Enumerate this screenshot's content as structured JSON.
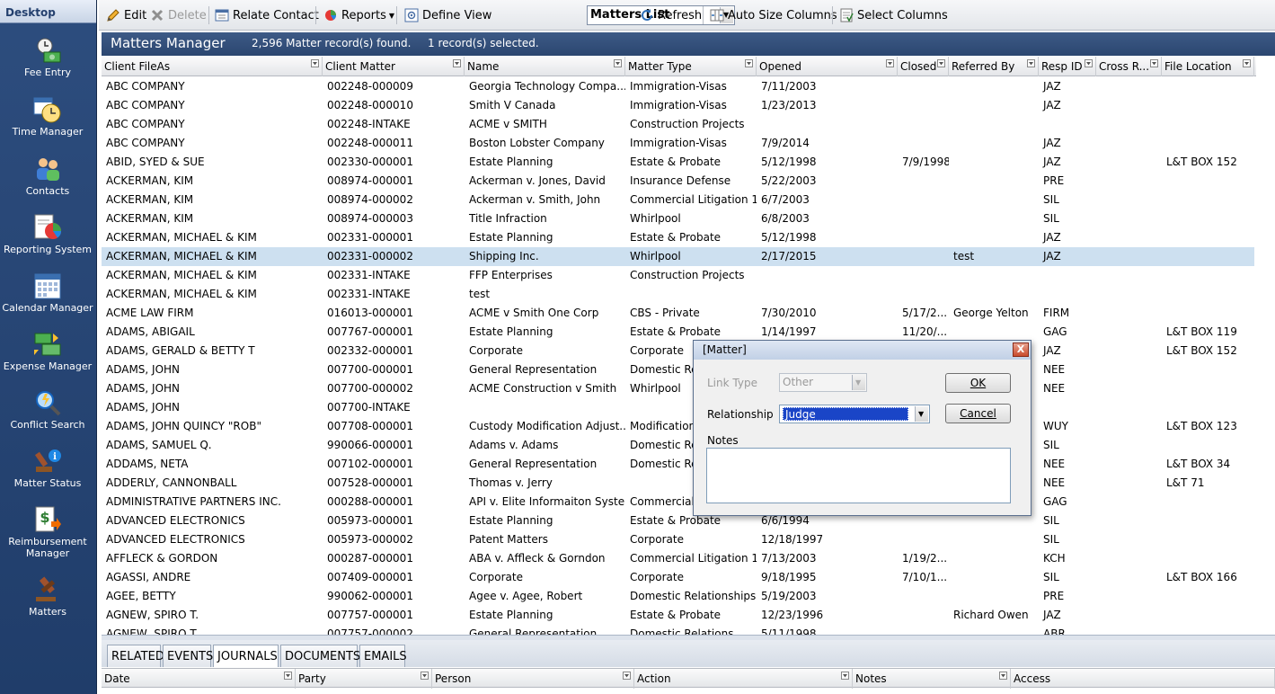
{
  "sidebar": {
    "title": "Desktop",
    "items": [
      {
        "label": "Fee Entry",
        "icon": "fee-entry-icon"
      },
      {
        "label": "Time Manager",
        "icon": "time-manager-icon"
      },
      {
        "label": "Contacts",
        "icon": "contacts-icon"
      },
      {
        "label": "Reporting System",
        "icon": "reporting-system-icon"
      },
      {
        "label": "Calendar Manager",
        "icon": "calendar-manager-icon"
      },
      {
        "label": "Expense Manager",
        "icon": "expense-manager-icon"
      },
      {
        "label": "Conflict Search",
        "icon": "conflict-search-icon"
      },
      {
        "label": "Matter Status",
        "icon": "matter-status-icon"
      },
      {
        "label": "Reimbursement Manager",
        "icon": "reimbursement-manager-icon"
      },
      {
        "label": "Matters",
        "icon": "matters-icon"
      }
    ]
  },
  "toolbar": {
    "edit": "Edit",
    "delete": "Delete",
    "relate_contact": "Relate Contact",
    "reports": "Reports",
    "define_view": "Define View",
    "view_value": "Matters List",
    "refresh": "Refresh",
    "auto_size": "Auto Size Columns",
    "select_columns": "Select Columns"
  },
  "header": {
    "title": "Matters Manager",
    "records_found": "2,596 Matter record(s) found.",
    "records_selected": "1 record(s) selected."
  },
  "columns": [
    "Client FileAs",
    "Client Matter",
    "Name",
    "Matter Type",
    "Opened",
    "Closed",
    "Referred By",
    "Resp ID",
    "Cross R...",
    "File Location"
  ],
  "rows": [
    [
      "ABC COMPANY",
      "002248-000009",
      "Georgia Technology Compa...",
      "Immigration-Visas",
      "7/11/2003",
      "",
      "",
      "JAZ",
      "",
      ""
    ],
    [
      "ABC COMPANY",
      "002248-000010",
      "Smith V Canada",
      "Immigration-Visas",
      "1/23/2013",
      "",
      "",
      "JAZ",
      "",
      ""
    ],
    [
      "ABC COMPANY",
      "002248-INTAKE",
      "ACME v SMITH",
      "Construction Projects",
      "",
      "",
      "",
      "",
      "",
      ""
    ],
    [
      "ABC COMPANY",
      "002248-000011",
      "Boston Lobster Company",
      "Immigration-Visas",
      "7/9/2014",
      "",
      "",
      "JAZ",
      "",
      ""
    ],
    [
      "ABID, SYED & SUE",
      "002330-000001",
      "Estate Planning",
      "Estate & Probate",
      "5/12/1998",
      "7/9/1998",
      "",
      "JAZ",
      "",
      "L&T BOX 152"
    ],
    [
      "ACKERMAN, KIM",
      "008974-000001",
      "Ackerman v. Jones, David",
      "Insurance Defense",
      "5/22/2003",
      "",
      "",
      "PRE",
      "",
      ""
    ],
    [
      "ACKERMAN, KIM",
      "008974-000002",
      "Ackerman v. Smith, John",
      "Commercial Litigation  1",
      "6/7/2003",
      "",
      "",
      "SIL",
      "",
      ""
    ],
    [
      "ACKERMAN, KIM",
      "008974-000003",
      "Title Infraction",
      "Whirlpool",
      "6/8/2003",
      "",
      "",
      "SIL",
      "",
      ""
    ],
    [
      "ACKERMAN, MICHAEL & KIM",
      "002331-000001",
      "Estate Planning",
      "Estate & Probate",
      "5/12/1998",
      "",
      "",
      "JAZ",
      "",
      ""
    ],
    [
      "ACKERMAN, MICHAEL & KIM",
      "002331-000002",
      "Shipping Inc.",
      "Whirlpool",
      "2/17/2015",
      "",
      "test",
      "JAZ",
      "",
      ""
    ],
    [
      "ACKERMAN, MICHAEL & KIM",
      "002331-INTAKE",
      "FFP Enterprises",
      "Construction Projects",
      "",
      "",
      "",
      "",
      "",
      ""
    ],
    [
      "ACKERMAN, MICHAEL & KIM",
      "002331-INTAKE",
      "test",
      "",
      "",
      "",
      "",
      "",
      "",
      ""
    ],
    [
      "ACME LAW FIRM",
      "016013-000001",
      "ACME v Smith One Corp",
      "CBS - Private",
      "7/30/2010",
      "5/17/2...",
      "George Yelton",
      "FIRM",
      "",
      ""
    ],
    [
      "ADAMS, ABIGAIL",
      "007767-000001",
      "Estate Planning",
      "Estate & Probate",
      "1/14/1997",
      "11/20/...",
      "",
      "GAG",
      "",
      "L&T BOX 119"
    ],
    [
      "ADAMS, GERALD & BETTY  T",
      "002332-000001",
      "Corporate",
      "Corporate",
      "",
      "",
      "",
      "JAZ",
      "",
      "L&T BOX 152"
    ],
    [
      "ADAMS, JOHN",
      "007700-000001",
      "General Representation",
      "Domestic Re",
      "",
      "",
      "",
      "NEE",
      "",
      ""
    ],
    [
      "ADAMS, JOHN",
      "007700-000002",
      "ACME Construction v Smith",
      "Whirlpool",
      "",
      "",
      "",
      "NEE",
      "",
      ""
    ],
    [
      "ADAMS, JOHN",
      "007700-INTAKE",
      "",
      "",
      "",
      "",
      "",
      "",
      "",
      ""
    ],
    [
      "ADAMS, JOHN QUINCY \"ROB\"",
      "007708-000001",
      "Custody Modification Adjust...",
      "Modification",
      "",
      "",
      "",
      "WUY",
      "",
      "L&T BOX 123"
    ],
    [
      "ADAMS, SAMUEL Q.",
      "990066-000001",
      "Adams v. Adams",
      "Domestic Re",
      "",
      "",
      "",
      "SIL",
      "",
      ""
    ],
    [
      "ADDAMS, NETA",
      "007102-000001",
      "General Representation",
      "Domestic Re",
      "",
      "",
      "",
      "NEE",
      "",
      "L&T BOX 34"
    ],
    [
      "ADDERLY, CANNONBALL",
      "007528-000001",
      "Thomas v. Jerry",
      "",
      "",
      "",
      "",
      "NEE",
      "",
      "L&T 71"
    ],
    [
      "ADMINISTRATIVE PARTNERS INC.",
      "000288-000001",
      "API v. Elite Informaiton Syste...",
      "Commercial",
      "",
      "",
      "",
      "GAG",
      "",
      ""
    ],
    [
      "ADVANCED ELECTRONICS",
      "005973-000001",
      "Estate Planning",
      "Estate & Probate",
      "6/6/1994",
      "",
      "",
      "SIL",
      "",
      ""
    ],
    [
      "ADVANCED ELECTRONICS",
      "005973-000002",
      "Patent Matters",
      "Corporate",
      "12/18/1997",
      "",
      "",
      "SIL",
      "",
      ""
    ],
    [
      "AFFLECK & GORDON",
      "000287-000001",
      "ABA v. Affleck & Gorndon",
      "Commercial Litigation  1",
      "7/13/2003",
      "1/19/2...",
      "",
      "KCH",
      "",
      ""
    ],
    [
      "AGASSI, ANDRE",
      "007409-000001",
      "Corporate",
      "Corporate",
      "9/18/1995",
      "7/10/1...",
      "",
      "SIL",
      "",
      "L&T BOX 166"
    ],
    [
      "AGEE, BETTY",
      "990062-000001",
      "Agee v. Agee, Robert",
      "Domestic Relationships",
      "5/19/2003",
      "",
      "",
      "PRE",
      "",
      ""
    ],
    [
      "AGNEW, SPIRO T.",
      "007757-000001",
      "Estate Planning",
      "Estate & Probate",
      "12/23/1996",
      "",
      "Richard Owen",
      "JAZ",
      "",
      ""
    ],
    [
      "AGNEW, SPIRO T.",
      "007757-000002",
      "General Representation",
      "Domestic Relations",
      "5/11/1998",
      "",
      "",
      "ABR",
      "",
      ""
    ]
  ],
  "selected_row": 9,
  "bottom_tabs": [
    "RELATED",
    "EVENTS",
    "JOURNALS",
    "DOCUMENTS",
    "EMAILS"
  ],
  "active_tab": "JOURNALS",
  "sub_columns": [
    "Date",
    "Party",
    "Person",
    "Action",
    "Notes",
    "Access"
  ],
  "dialog": {
    "title": "[Matter]",
    "link_type_label": "Link Type",
    "link_type_value": "Other",
    "relationship_label": "Relationship",
    "relationship_value": "Judge",
    "notes_label": "Notes",
    "ok": "OK",
    "cancel": "Cancel",
    "close": "X"
  },
  "colors": {
    "sidebar_bg": "#2d4d7e",
    "header_bg": "#3d5a86",
    "selected_row": "#cde0f0",
    "selection_highlight": "#1a45c7"
  }
}
